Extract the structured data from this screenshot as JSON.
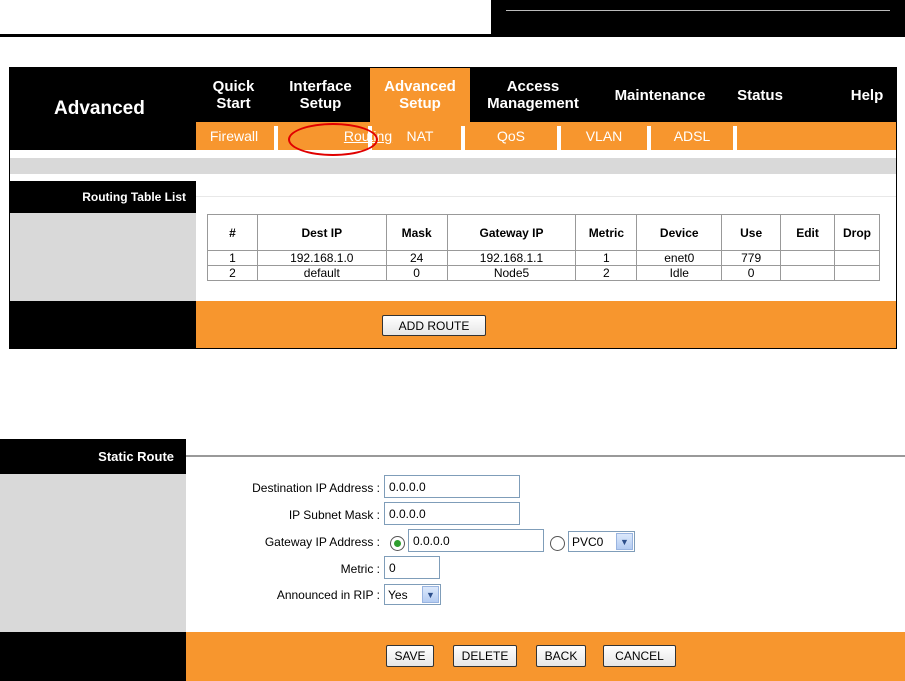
{
  "brand": "Advanced",
  "nav": [
    {
      "label_line1": "Quick",
      "label_line2": "Start"
    },
    {
      "label_line1": "Interface",
      "label_line2": "Setup"
    },
    {
      "label_line1": "Advanced",
      "label_line2": "Setup"
    },
    {
      "label_line1": "Access",
      "label_line2": "Management"
    },
    {
      "label_line1": "Maintenance",
      "label_line2": ""
    },
    {
      "label_line1": "Status",
      "label_line2": ""
    },
    {
      "label_line1": "Help",
      "label_line2": ""
    }
  ],
  "subnav": [
    "Firewall",
    "Routing",
    "NAT",
    "QoS",
    "VLAN",
    "ADSL"
  ],
  "routing_table": {
    "section_title": "Routing Table List",
    "headers": [
      "#",
      "Dest IP",
      "Mask",
      "Gateway IP",
      "Metric",
      "Device",
      "Use",
      "Edit",
      "Drop"
    ],
    "rows": [
      [
        "1",
        "192.168.1.0",
        "24",
        "192.168.1.1",
        "1",
        "enet0",
        "779",
        "",
        ""
      ],
      [
        "2",
        "default",
        "0",
        "Node5",
        "2",
        "Idle",
        "0",
        "",
        ""
      ]
    ],
    "add_button": "ADD ROUTE"
  },
  "static_route": {
    "section_title": "Static Route",
    "dest_ip_label": "Destination IP Address :",
    "dest_ip_value": "0.0.0.0",
    "mask_label": "IP Subnet Mask :",
    "mask_value": "0.0.0.0",
    "gateway_label": "Gateway IP Address :",
    "gateway_value": "0.0.0.0",
    "gateway_pvc": "PVC0",
    "metric_label": "Metric :",
    "metric_value": "0",
    "rip_label": "Announced in RIP :",
    "rip_value": "Yes",
    "buttons": {
      "save": "SAVE",
      "delete": "DELETE",
      "back": "BACK",
      "cancel": "CANCEL"
    }
  },
  "colors": {
    "accent": "#f7962e",
    "header": "#000000",
    "panel_grey": "#d9d9d9",
    "annotation": "#e00000"
  }
}
